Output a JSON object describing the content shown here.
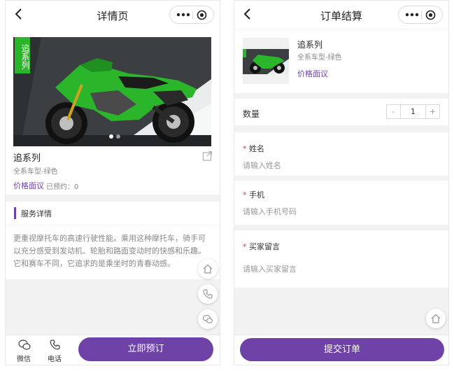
{
  "detail": {
    "nav_title": "详情页",
    "hero_tag": "追系列",
    "product_name": "追系列",
    "spec": "全系车型-绿色",
    "price": "价格面议",
    "reserved": "已预约：0",
    "section_title": "服务详情",
    "description": "更重视摩托车的高速行驶性能。乘用这种摩托车，骑手可以充分感受到发动机、轮胎和路面变动时的快感和乐趣。它和赛车不同，它追求的是乘坐时的青春动感。",
    "bottom": {
      "wechat": "微信",
      "phone": "电话",
      "reserve": "立即预订"
    }
  },
  "checkout": {
    "nav_title": "订单结算",
    "product_name": "追系列",
    "spec": "全系车型-绿色",
    "price": "价格面议",
    "quantity_label": "数量",
    "quantity_minus": "-",
    "quantity_value": "1",
    "quantity_plus": "+",
    "required_mark": "*",
    "name_label": "姓名",
    "name_placeholder": "请输入姓名",
    "phone_label": "手机",
    "phone_placeholder": "请输入手机号码",
    "message_label": "买家留言",
    "message_placeholder": "请输入买家留言",
    "submit": "提交订单"
  },
  "colors": {
    "accent": "#6f42a8",
    "bike_green": "#2bb52b",
    "required": "#e53935"
  }
}
